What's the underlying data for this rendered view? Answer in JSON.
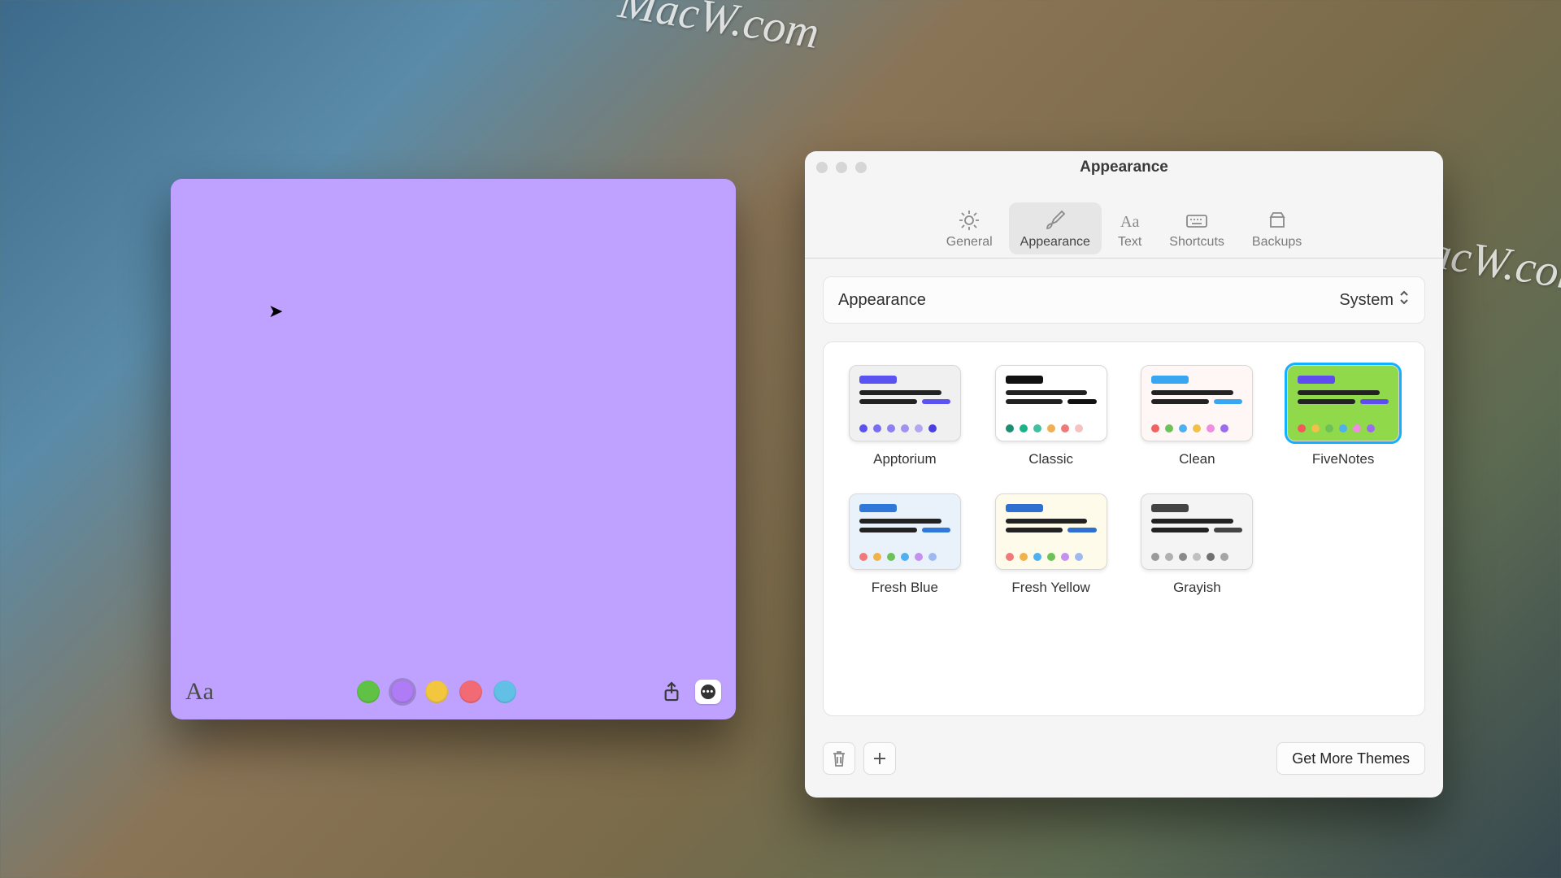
{
  "watermark": "MacW.com",
  "note": {
    "text_tool_label": "Aa",
    "colors": [
      {
        "name": "green",
        "hex": "#5fc245",
        "selected": false
      },
      {
        "name": "purple",
        "hex": "#b07cf5",
        "selected": true
      },
      {
        "name": "yellow",
        "hex": "#f2c63e",
        "selected": false
      },
      {
        "name": "coral",
        "hex": "#f26a74",
        "selected": false
      },
      {
        "name": "blue",
        "hex": "#62c0e6",
        "selected": false
      }
    ]
  },
  "prefs": {
    "title": "Appearance",
    "tabs": [
      {
        "id": "general",
        "label": "General"
      },
      {
        "id": "appearance",
        "label": "Appearance"
      },
      {
        "id": "text",
        "label": "Text"
      },
      {
        "id": "shortcuts",
        "label": "Shortcuts"
      },
      {
        "id": "backups",
        "label": "Backups"
      }
    ],
    "active_tab": "appearance",
    "appearance_row": {
      "label": "Appearance",
      "selected": "System"
    },
    "themes": [
      {
        "id": "apptorium",
        "label": "Apptorium",
        "selected": false,
        "bg": "#f0f0f0",
        "accent": "#5b52f2",
        "dots": [
          "#5b52f2",
          "#7a6df2",
          "#8d80f2",
          "#a192f2",
          "#b5a6f2",
          "#4a3fe0"
        ]
      },
      {
        "id": "classic",
        "label": "Classic",
        "selected": false,
        "bg": "#ffffff",
        "accent": "#111",
        "dots": [
          "#1b8f72",
          "#18b488",
          "#41c0a1",
          "#f0af52",
          "#f07a7a",
          "#f5c1c1"
        ]
      },
      {
        "id": "clean",
        "label": "Clean",
        "selected": false,
        "bg": "#fff7f6",
        "accent": "#3aa5f0",
        "dots": [
          "#f26060",
          "#6cc259",
          "#4fb0f0",
          "#f0c04a",
          "#f08de0",
          "#9c6cf0"
        ]
      },
      {
        "id": "fivenotes",
        "label": "FiveNotes",
        "selected": true,
        "bg": "#8fd94a",
        "accent": "#5e4cf0",
        "dots": [
          "#f05a5a",
          "#f0c04a",
          "#6cc259",
          "#4fb0f0",
          "#f08de0",
          "#9c6cf0"
        ]
      },
      {
        "id": "fresh-blue",
        "label": "Fresh Blue",
        "selected": false,
        "bg": "#e9f2fb",
        "accent": "#2f77d8",
        "dots": [
          "#f07a7a",
          "#f0b24a",
          "#6cc259",
          "#4fb0f0",
          "#c590f0",
          "#9fb8f0"
        ]
      },
      {
        "id": "fresh-yellow",
        "label": "Fresh Yellow",
        "selected": false,
        "bg": "#fffbea",
        "accent": "#2f6fd0",
        "dots": [
          "#f07a7a",
          "#f0b24a",
          "#4fb0f0",
          "#6cc259",
          "#c590f0",
          "#9fb8f0"
        ]
      },
      {
        "id": "grayish",
        "label": "Grayish",
        "selected": false,
        "bg": "#f4f4f4",
        "accent": "#444",
        "dots": [
          "#9a9a9a",
          "#b0b0b0",
          "#8a8a8a",
          "#c0c0c0",
          "#707070",
          "#a5a5a5"
        ]
      }
    ],
    "footer": {
      "more_themes_label": "Get More Themes"
    }
  }
}
